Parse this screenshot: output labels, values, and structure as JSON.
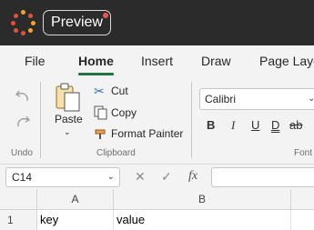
{
  "title_bar": {
    "preview_label": "Preview"
  },
  "tabs": [
    {
      "label": "File"
    },
    {
      "label": "Home"
    },
    {
      "label": "Insert"
    },
    {
      "label": "Draw"
    },
    {
      "label": "Page Layo"
    }
  ],
  "ribbon": {
    "undo_group_label": "Undo",
    "paste_label": "Paste",
    "cut_label": "Cut",
    "copy_label": "Copy",
    "format_painter_label": "Format Painter",
    "clipboard_group_label": "Clipboard",
    "font_name": "Calibri",
    "font_group_label": "Font",
    "bold": "B",
    "italic": "I",
    "underline": "U",
    "double_underline": "D",
    "strikethrough": "ab"
  },
  "formula_bar": {
    "name_box_value": "C14",
    "fx_label": "fx"
  },
  "grid": {
    "columns": [
      "A",
      "B"
    ],
    "rows": [
      {
        "number": "1",
        "cells": [
          "key",
          "value"
        ]
      }
    ]
  },
  "colors": {
    "accent": "#217346",
    "title_bar": "#2b2b2b"
  }
}
